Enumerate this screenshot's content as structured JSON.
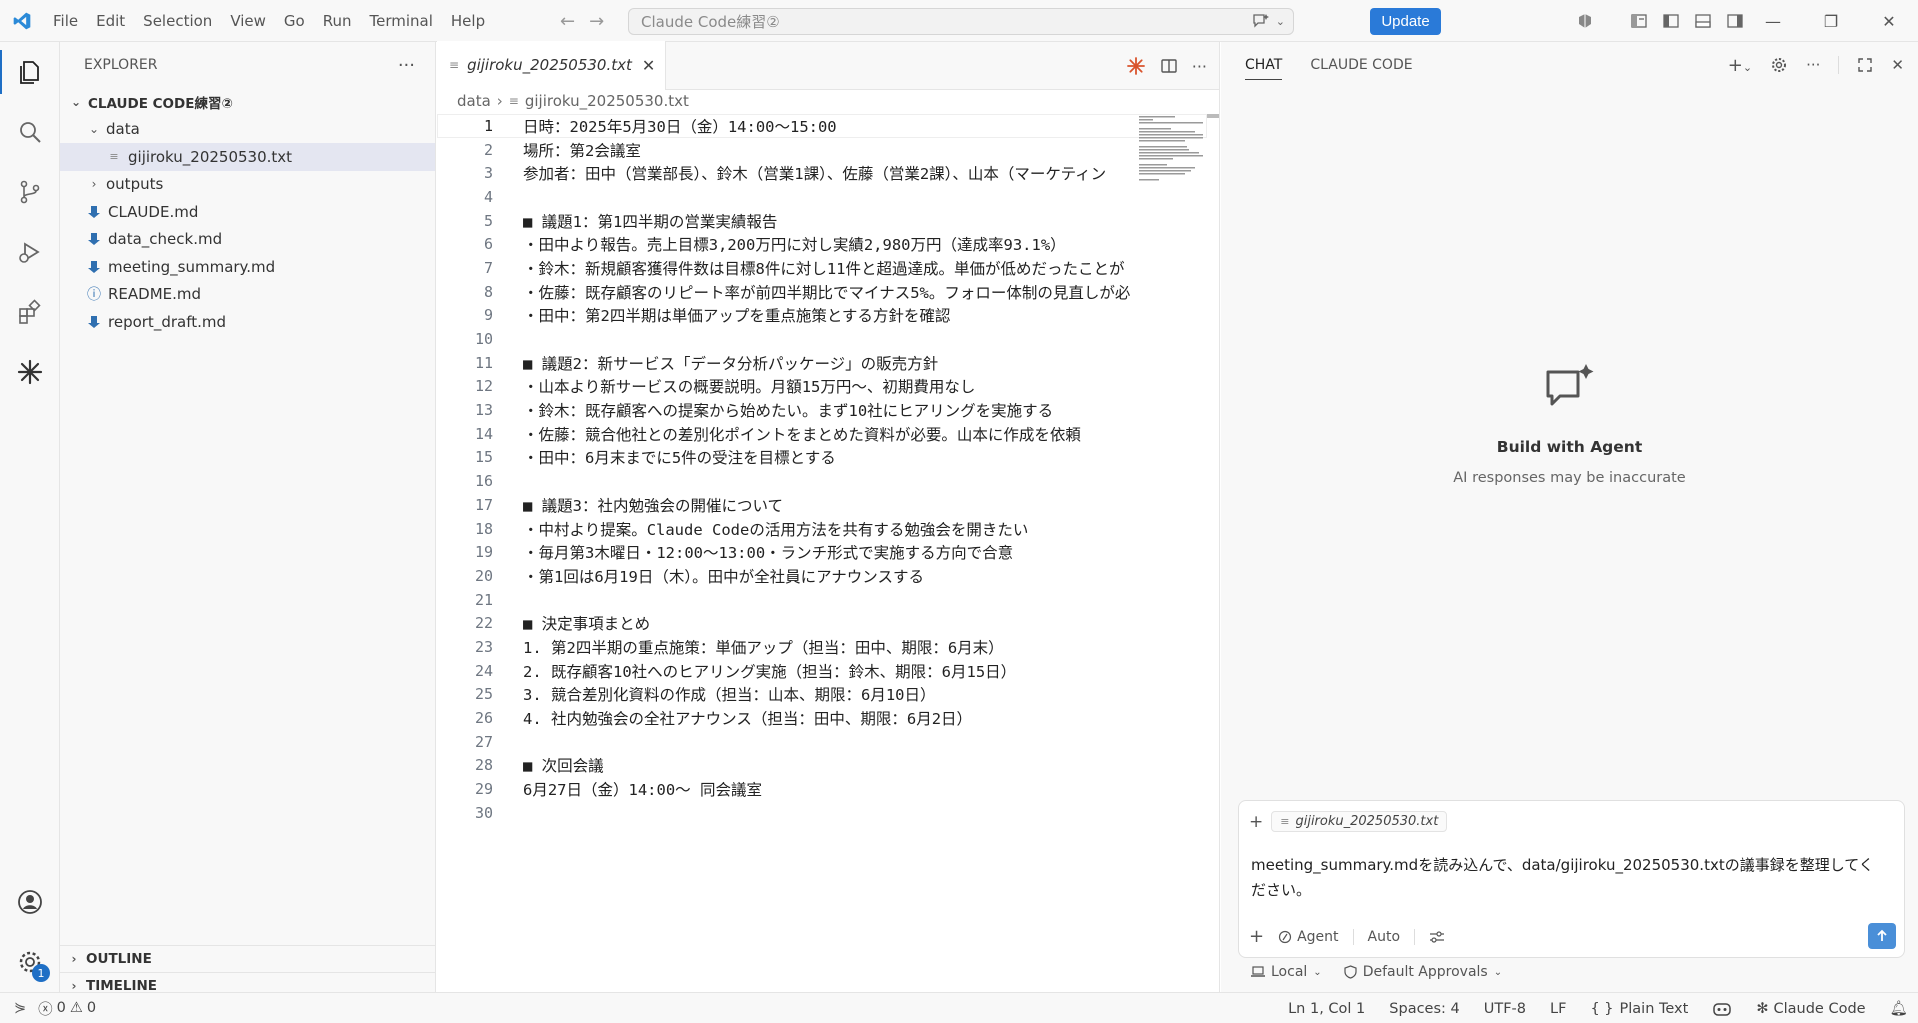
{
  "menu": [
    "File",
    "Edit",
    "Selection",
    "View",
    "Go",
    "Run",
    "Terminal",
    "Help"
  ],
  "command_center": {
    "placeholder": "Claude Code練習②"
  },
  "update_label": "Update",
  "sidebar": {
    "title": "EXPLORER",
    "root": "CLAUDE CODE練習②",
    "items": [
      {
        "label": "data",
        "type": "folder-open",
        "depth": 1
      },
      {
        "label": "gijiroku_20250530.txt",
        "type": "text",
        "depth": 2,
        "selected": true
      },
      {
        "label": "outputs",
        "type": "folder",
        "depth": 1
      },
      {
        "label": "CLAUDE.md",
        "type": "markdown",
        "depth": 1
      },
      {
        "label": "data_check.md",
        "type": "markdown",
        "depth": 1
      },
      {
        "label": "meeting_summary.md",
        "type": "markdown",
        "depth": 1
      },
      {
        "label": "README.md",
        "type": "info",
        "depth": 1
      },
      {
        "label": "report_draft.md",
        "type": "markdown",
        "depth": 1
      }
    ],
    "outline": "OUTLINE",
    "timeline": "TIMELINE"
  },
  "editor": {
    "tab_label": "gijiroku_20250530.txt",
    "breadcrumb": [
      "data",
      "gijiroku_20250530.txt"
    ],
    "lines": [
      "日時：2025年5月30日（金）14:00〜15:00",
      "場所：第2会議室",
      "参加者：田中（営業部長）、鈴木（営業1課）、佐藤（営業2課）、山本（マーケティン",
      "",
      "■ 議題1：第1四半期の営業実績報告",
      "・田中より報告。売上目標3,200万円に対し実績2,980万円（達成率93.1%）",
      "・鈴木：新規顧客獲得件数は目標8件に対し11件と超過達成。単価が低めだったことが",
      "・佐藤：既存顧客のリピート率が前四半期比でマイナス5%。フォロー体制の見直しが必",
      "・田中：第2四半期は単価アップを重点施策とする方針を確認",
      "",
      "■ 議題2：新サービス「データ分析パッケージ」の販売方針",
      "・山本より新サービスの概要説明。月額15万円〜、初期費用なし",
      "・鈴木：既存顧客への提案から始めたい。まず10社にヒアリングを実施する",
      "・佐藤：競合他社との差別化ポイントをまとめた資料が必要。山本に作成を依頼",
      "・田中：6月末までに5件の受注を目標とする",
      "",
      "■ 議題3：社内勉強会の開催について",
      "・中村より提案。Claude Codeの活用方法を共有する勉強会を開きたい",
      "・毎月第3木曜日・12:00〜13:00・ランチ形式で実施する方向で合意",
      "・第1回は6月19日（木）。田中が全社員にアナウンスする",
      "",
      "■ 決定事項まとめ",
      "1. 第2四半期の重点施策：単価アップ（担当：田中、期限：6月末）",
      "2. 既存顧客10社へのヒアリング実施（担当：鈴木、期限：6月15日）",
      "3. 競合差別化資料の作成（担当：山本、期限：6月10日）",
      "4. 社内勉強会の全社アナウンス（担当：田中、期限：6月2日）",
      "",
      "■ 次回会議",
      "6月27日（金）14:00〜 同会議室",
      ""
    ]
  },
  "chat": {
    "tabs": [
      "CHAT",
      "CLAUDE CODE"
    ],
    "hero_title": "Build with Agent",
    "hero_subtitle": "AI responses may be inaccurate",
    "context_chip": "gijiroku_20250530.txt",
    "prompt": "meeting_summary.mdを読み込んで、data/gijiroku_20250530.txtの議事録を整理してください。",
    "mode": "Agent",
    "model": "Auto",
    "footer_local": "Local",
    "footer_approvals": "Default Approvals"
  },
  "status": {
    "errors": "0",
    "warnings": "0",
    "position": "Ln 1, Col 1",
    "spaces": "Spaces: 4",
    "encoding": "UTF-8",
    "eol": "LF",
    "language": "Plain Text",
    "claude": "Claude Code"
  },
  "colors": {
    "accent": "#1f6fc5",
    "update": "#2a7ad8",
    "claude": "#d9532c"
  }
}
